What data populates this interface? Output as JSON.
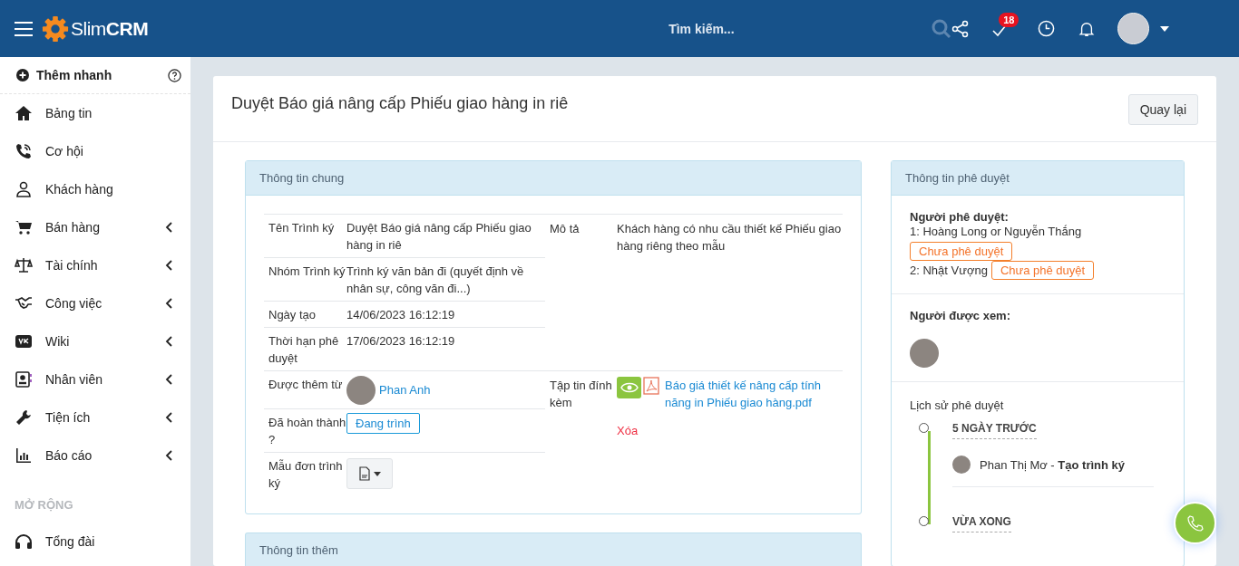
{
  "header": {
    "logo_light": "Slim",
    "logo_bold": "CRM",
    "search": {
      "placeholder": "Tìm kiếm..."
    },
    "badge": "18"
  },
  "sidebar": {
    "quick_add": "Thêm nhanh",
    "items": [
      {
        "label": "Bảng tin",
        "expandable": false
      },
      {
        "label": "Cơ hội",
        "expandable": false
      },
      {
        "label": "Khách hàng",
        "expandable": false
      },
      {
        "label": "Bán hàng",
        "expandable": true
      },
      {
        "label": "Tài chính",
        "expandable": true
      },
      {
        "label": "Công việc",
        "expandable": true
      },
      {
        "label": "Wiki",
        "expandable": true
      },
      {
        "label": "Nhân viên",
        "expandable": true
      },
      {
        "label": "Tiện ích",
        "expandable": true
      },
      {
        "label": "Báo cáo",
        "expandable": true
      }
    ],
    "section": "MỞ RỘNG",
    "extra_items": [
      {
        "label": "Tổng đài",
        "expandable": false
      }
    ]
  },
  "page": {
    "title": "Duyệt Báo giá nâng cấp Phiếu giao hàng in riê",
    "back_button": "Quay lại"
  },
  "general_info": {
    "title": "Thông tin chung",
    "sections": [
      {
        "left": [
          {
            "kind": "text",
            "label": "Tên Trình ký",
            "value": "Duyệt Báo giá nâng cấp Phiếu giao hàng in riê"
          },
          {
            "kind": "text",
            "label": "Nhóm Trình ký",
            "value": "Trình ký văn bản đi (quyết định về nhân sự, công văn đi...)"
          },
          {
            "kind": "text",
            "label": "Ngày tạo",
            "value": "14/06/2023 16:12:19"
          },
          {
            "kind": "text",
            "label": "Thời hạn phê duyệt",
            "value": "17/06/2023 16:12:19"
          }
        ],
        "right": {
          "kind": "text",
          "label": "Mô tả",
          "value": "Khách hàng có nhu cầu thiết kế Phiếu giao hàng riêng theo mẫu"
        }
      },
      {
        "left": [
          {
            "kind": "user",
            "label": "Được thêm từ",
            "value": "Phan Anh"
          },
          {
            "kind": "status",
            "label": "Đã hoàn thành ?",
            "value": "Đang trình"
          },
          {
            "kind": "template",
            "label": "Mẫu đơn trình ký"
          }
        ],
        "right": {
          "kind": "attachment",
          "label": "Tập tin đính kèm",
          "value": "Báo giá thiết kế nâng cấp tính năng in Phiếu giao hàng.pdf",
          "delete": "Xóa"
        }
      }
    ]
  },
  "extra_info": {
    "title": "Thông tin thêm"
  },
  "approval": {
    "title": "Thông tin phê duyệt",
    "approvers_label": "Người phê duyệt:",
    "approvers": [
      {
        "name": "1: Hoàng Long or Nguyễn Thắng",
        "status": "Chưa phê duyệt"
      },
      {
        "name": "2: Nhật Vượng",
        "status": "Chưa phê duyệt"
      }
    ],
    "viewers_label": "Người được xem:",
    "history_label": "Lịch sử phê duyệt",
    "history": [
      {
        "time": "5 NGÀY TRƯỚC",
        "entry": "Phan Thị Mơ - **Tạo trình ký**"
      },
      {
        "time": "VỪA XONG"
      }
    ]
  }
}
